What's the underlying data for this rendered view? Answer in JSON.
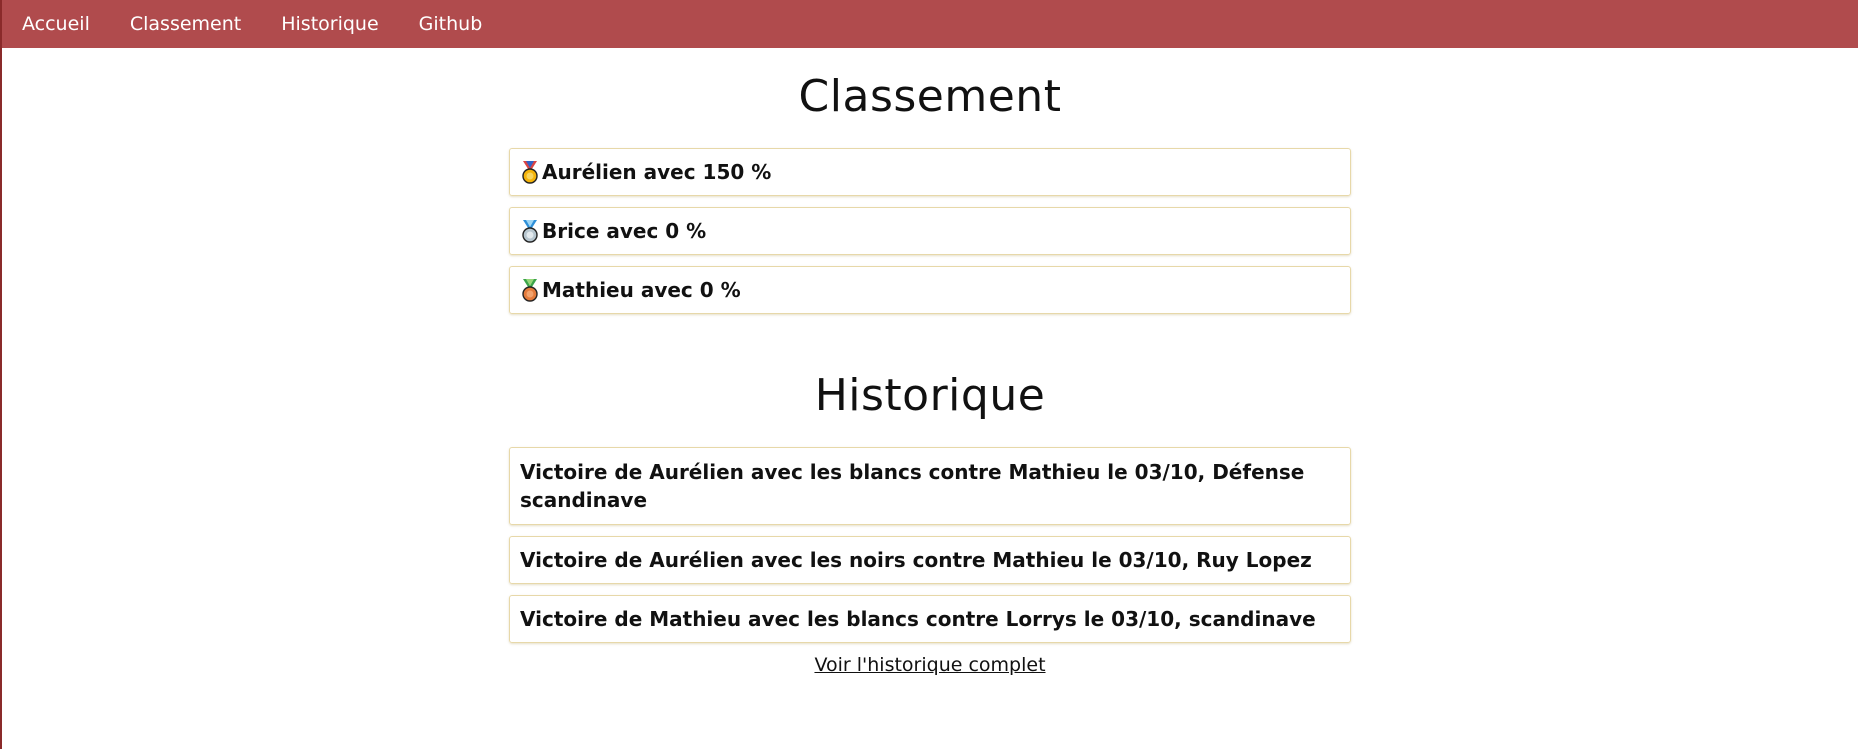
{
  "nav": {
    "items": [
      "Accueil",
      "Classement",
      "Historique",
      "Github"
    ]
  },
  "ranking": {
    "title": "Classement",
    "entries": [
      {
        "text": "Aurélien avec 150 %",
        "medal": "gold-medal-icon"
      },
      {
        "text": "Brice avec 0 %",
        "medal": "silver-medal-icon"
      },
      {
        "text": "Mathieu avec 0 %",
        "medal": "bronze-medal-icon"
      }
    ]
  },
  "history": {
    "title": "Historique",
    "entries": [
      "Victoire de Aurélien avec les blancs contre Mathieu le 03/10, Défense scandinave",
      "Victoire de Aurélien avec les noirs contre Mathieu le 03/10, Ruy Lopez",
      "Victoire de Mathieu avec les blancs contre Lorrys le 03/10, scandinave"
    ],
    "link": "Voir l'historique complet"
  },
  "colors": {
    "navbar": "#b04b4d",
    "card_border": "#e7d8a9",
    "gold": "#f5b40a",
    "silver": "#b7c6cf",
    "bronze": "#e47b3c"
  }
}
